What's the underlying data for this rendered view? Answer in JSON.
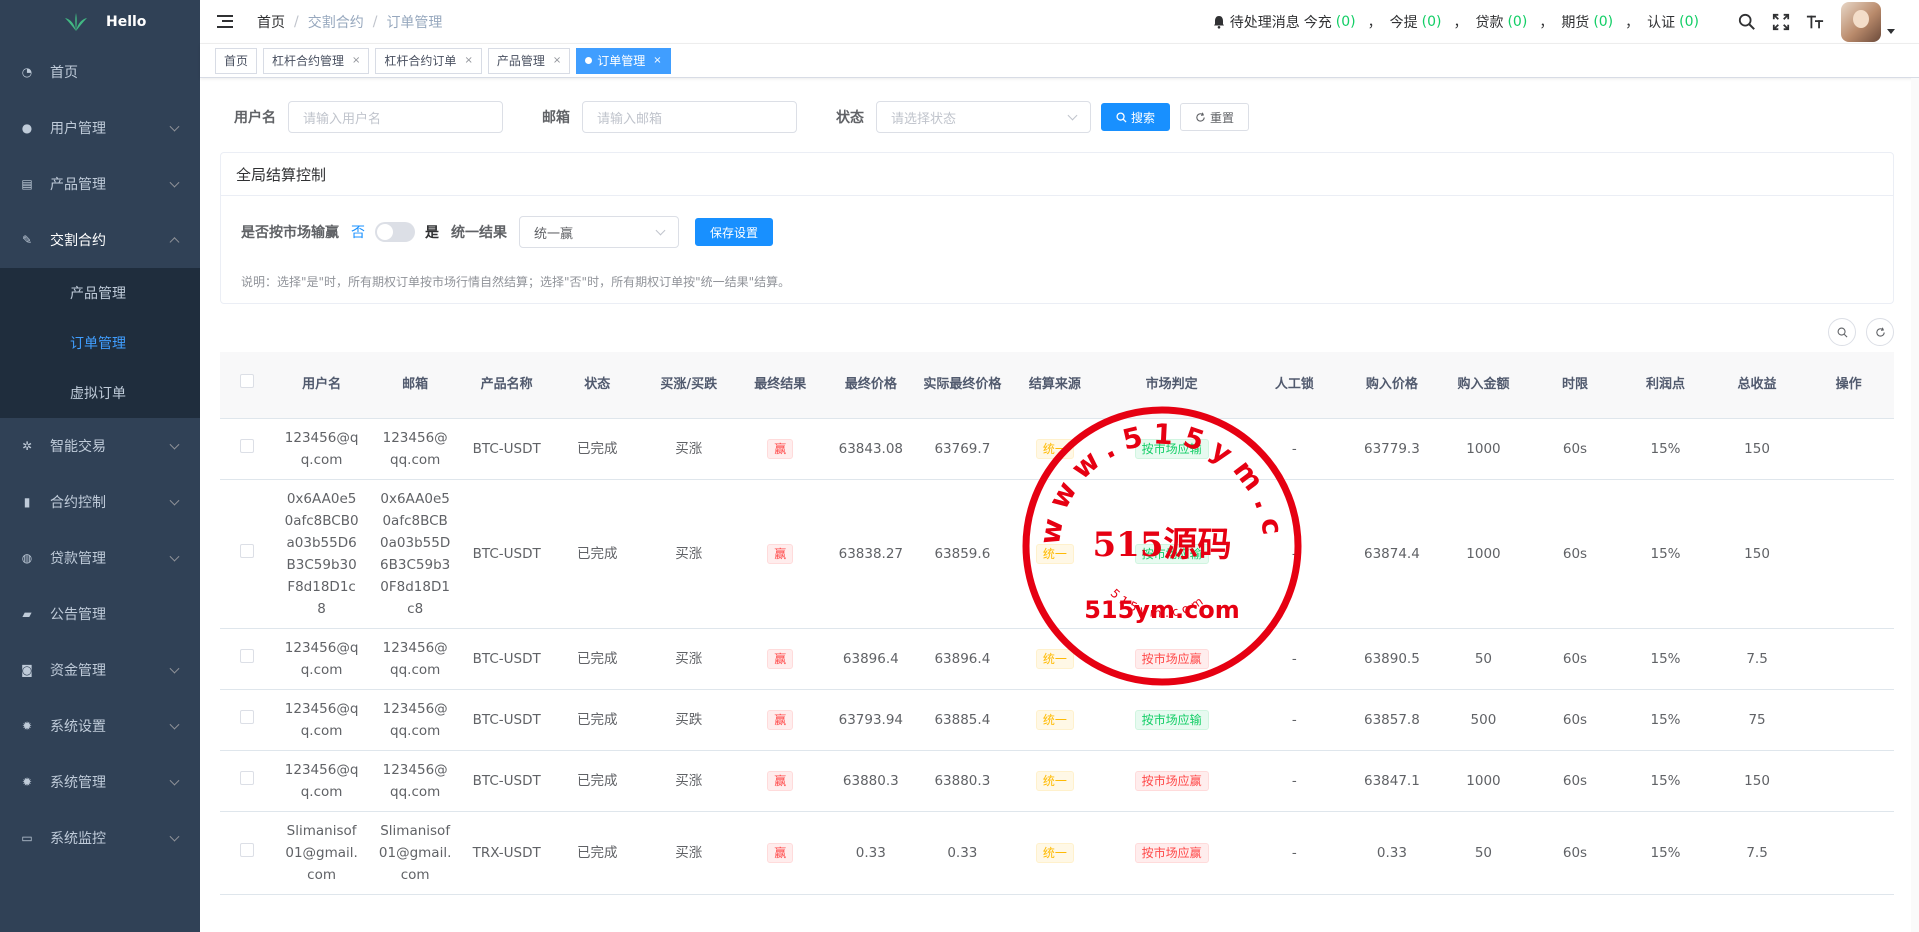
{
  "app": {
    "title": "Hello"
  },
  "sidebar": {
    "items": [
      {
        "label": "首页",
        "icon": "dashboard-icon"
      },
      {
        "label": "用户管理",
        "icon": "user-icon"
      },
      {
        "label": "产品管理",
        "icon": "document-icon"
      },
      {
        "label": "交割合约",
        "icon": "edit-icon"
      },
      {
        "label": "智能交易",
        "icon": "gear-small-icon"
      },
      {
        "label": "合约控制",
        "icon": "bar-chart-icon"
      },
      {
        "label": "贷款管理",
        "icon": "money-icon"
      },
      {
        "label": "公告管理",
        "icon": "message-icon"
      },
      {
        "label": "资金管理",
        "icon": "wallet-icon"
      },
      {
        "label": "系统设置",
        "icon": "gear-icon"
      },
      {
        "label": "系统管理",
        "icon": "gear-icon"
      },
      {
        "label": "系统监控",
        "icon": "monitor-icon"
      }
    ],
    "submenu": [
      "产品管理",
      "订单管理",
      "虚拟订单"
    ]
  },
  "breadcrumb": [
    "首页",
    "交割合约",
    "订单管理"
  ],
  "notice": {
    "label": "待处理消息",
    "items": [
      {
        "label": "今充",
        "count": "(0)"
      },
      {
        "label": "今提",
        "count": "(0)"
      },
      {
        "label": "贷款",
        "count": "(0)"
      },
      {
        "label": "期货",
        "count": "(0)"
      },
      {
        "label": "认证",
        "count": "(0)"
      }
    ],
    "sep": "，"
  },
  "tags": [
    {
      "label": "首页",
      "closable": false
    },
    {
      "label": "杠杆合约管理",
      "closable": true
    },
    {
      "label": "杠杆合约订单",
      "closable": true
    },
    {
      "label": "产品管理",
      "closable": true
    },
    {
      "label": "订单管理",
      "closable": true
    }
  ],
  "tag_close": "×",
  "filter": {
    "username_label": "用户名",
    "username_placeholder": "请输入用户名",
    "email_label": "邮箱",
    "email_placeholder": "请输入邮箱",
    "status_label": "状态",
    "status_placeholder": "请选择状态",
    "search": "搜索",
    "reset": "重置"
  },
  "settings": {
    "title": "全局结算控制",
    "market_label": "是否按市场输赢",
    "no": "否",
    "yes": "是",
    "result_label": "统一结果",
    "result_value": "统一赢",
    "save": "保存设置",
    "note": "说明：选择\"是\"时，所有期权订单按市场行情自然结算；选择\"否\"时，所有期权订单按\"统一结果\"结算。"
  },
  "table": {
    "headers": [
      "用户名",
      "邮箱",
      "产品名称",
      "状态",
      "买涨/买跌",
      "最终结果",
      "最终价格",
      "实际最终价格",
      "结算来源",
      "市场判定",
      "人工锁",
      "购入价格",
      "购入金额",
      "时限",
      "利润点",
      "总收益",
      "操作"
    ],
    "rows": [
      [
        "123456@qq.com",
        "123456@qq.com",
        "BTC-USDT",
        "已完成",
        "买涨",
        "赢",
        "63843.08",
        "63769.7",
        "统一",
        "按市场应输",
        "-",
        "63779.3",
        "1000",
        "60s",
        "15%",
        "150",
        ""
      ],
      [
        "0x6AA0e50afc8BCB0a03b55D6B3C59b30F8d18D1c8",
        "0x6AA0e50afc8BCB0a03b55D6B3C59b30F8d18D1c8",
        "BTC-USDT",
        "已完成",
        "买涨",
        "赢",
        "63838.27",
        "63859.6",
        "统一",
        "按市场应输",
        "-",
        "63874.4",
        "1000",
        "60s",
        "15%",
        "150",
        ""
      ],
      [
        "123456@qq.com",
        "123456@qq.com",
        "BTC-USDT",
        "已完成",
        "买涨",
        "赢",
        "63896.4",
        "63896.4",
        "统一",
        "按市场应赢",
        "-",
        "63890.5",
        "50",
        "60s",
        "15%",
        "7.5",
        ""
      ],
      [
        "123456@qq.com",
        "123456@qq.com",
        "BTC-USDT",
        "已完成",
        "买跌",
        "赢",
        "63793.94",
        "63885.4",
        "统一",
        "按市场应输",
        "-",
        "63857.8",
        "500",
        "60s",
        "15%",
        "75",
        ""
      ],
      [
        "123456@qq.com",
        "123456@qq.com",
        "BTC-USDT",
        "已完成",
        "买涨",
        "赢",
        "63880.3",
        "63880.3",
        "统一",
        "按市场应赢",
        "-",
        "63847.1",
        "1000",
        "60s",
        "15%",
        "150",
        ""
      ],
      [
        "Slimanisof01@gmail.com",
        "Slimanisof01@gmail.com",
        "TRX-USDT",
        "已完成",
        "买涨",
        "赢",
        "0.33",
        "0.33",
        "统一",
        "按市场应赢",
        "-",
        "0.33",
        "50",
        "60s",
        "15%",
        "7.5",
        ""
      ]
    ]
  },
  "watermark": {
    "arc_top": "www.515ym.com",
    "center": "515源码",
    "bottom": "515ym.com",
    "arc_bottom": "515ym.com"
  },
  "colors": {
    "sidebar": "#304156",
    "submenu": "#1f2d3d",
    "primary": "#1890ff",
    "active_tag": "#409eff",
    "win": "#ff4949",
    "green": "#13ce66",
    "watermark": "#e60012"
  }
}
